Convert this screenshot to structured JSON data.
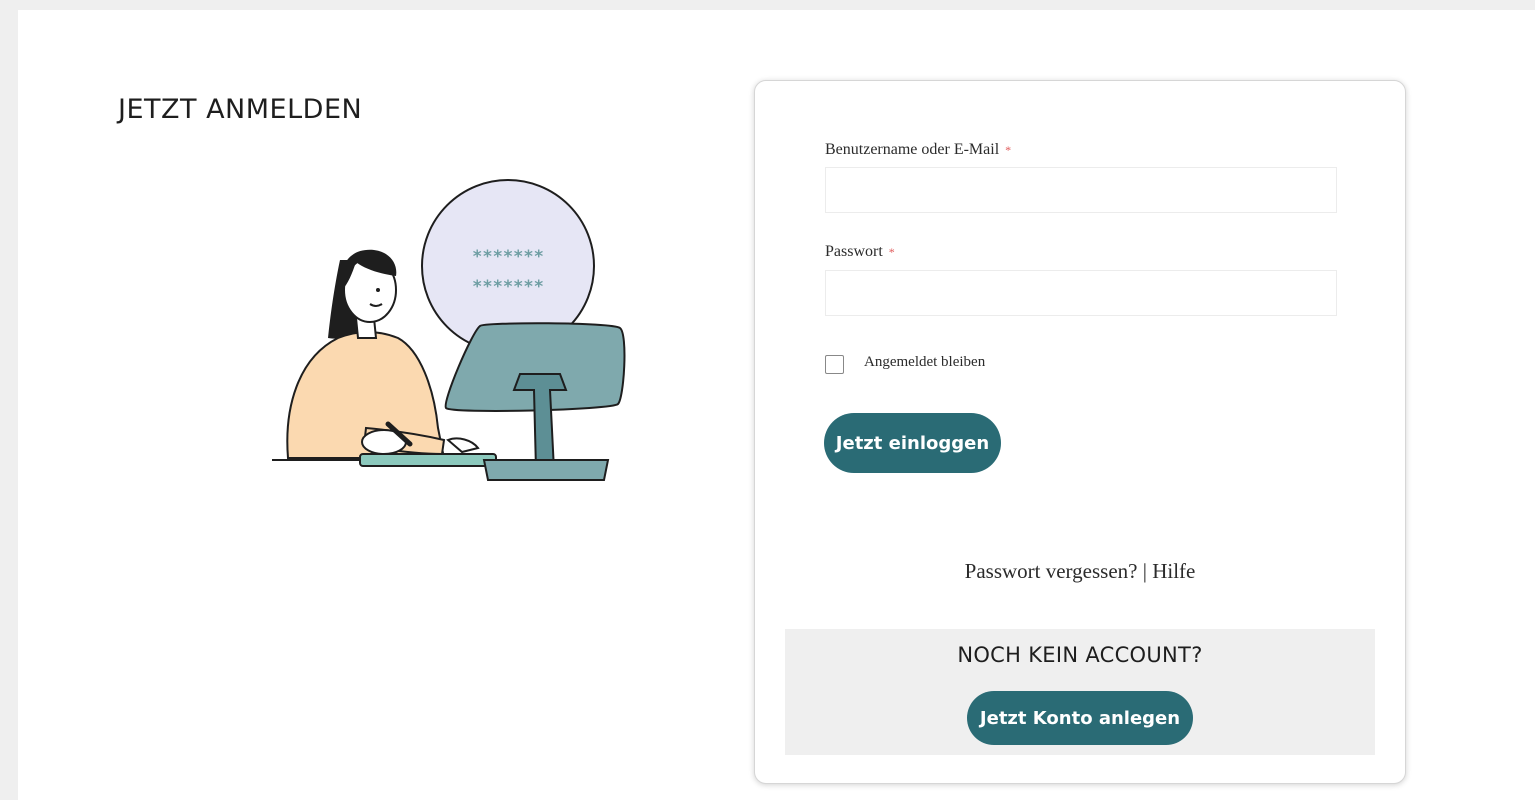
{
  "page": {
    "title": "JETZT ANMELDEN"
  },
  "illustration": {
    "password_mask_line1": "*******",
    "password_mask_line2": "*******"
  },
  "login_form": {
    "username_label": "Benutzername oder E-Mail",
    "username_required_mark": "*",
    "username_value": "",
    "password_label": "Passwort",
    "password_required_mark": "*",
    "password_value": "",
    "remember_label": "Angemeldet bleiben",
    "remember_checked": false,
    "submit_label": "Jetzt einloggen"
  },
  "help_links": {
    "forgot_password": "Passwort vergessen?",
    "separator": " | ",
    "help": "Hilfe"
  },
  "register": {
    "heading": "NOCH KEIN ACCOUNT?",
    "button_label": "Jetzt Konto anlegen"
  },
  "colors": {
    "accent": "#2a6b75",
    "required": "#e05a5a",
    "panel_gray": "#efefef",
    "skin_sweater": "#fbd9b0",
    "monitor": "#7fa9ad",
    "bubble": "#e6e6f5"
  }
}
